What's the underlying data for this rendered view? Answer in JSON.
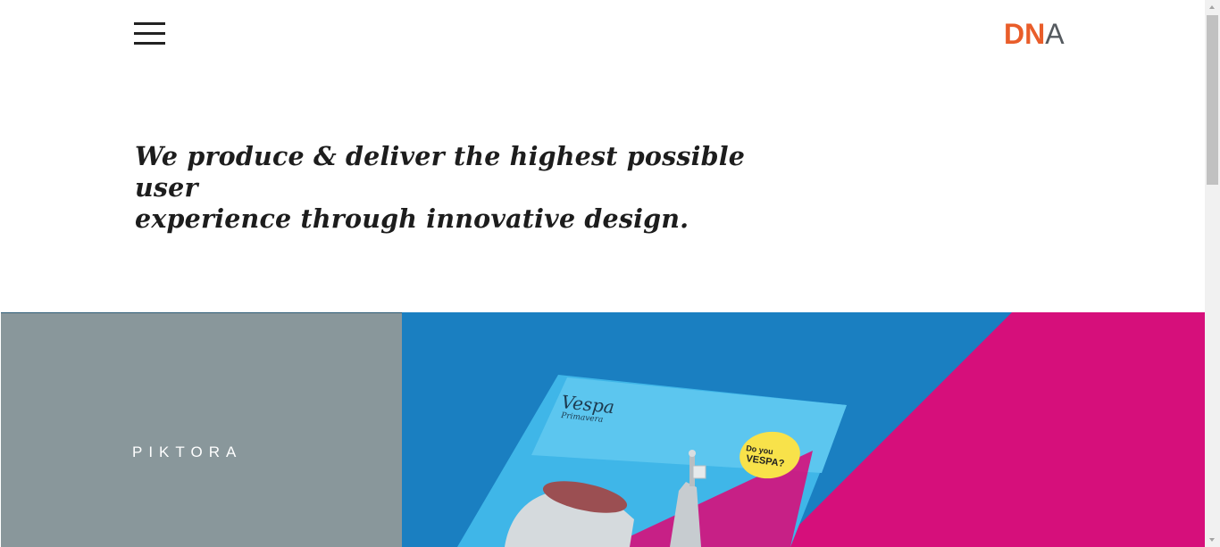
{
  "header": {
    "menu_icon": "hamburger-menu-icon",
    "logo": {
      "part_1": "DN",
      "part_2": "A",
      "accent_color": "#e95d2a",
      "text_color": "#555a5f"
    }
  },
  "hero": {
    "tagline_line_1": "We produce & deliver the highest possible user",
    "tagline_line_2": "experience through innovative design."
  },
  "projects": [
    {
      "name": "PIKTORA",
      "background": "#89979b"
    },
    {
      "image_brand": "Vespa",
      "image_subtitle": "Primavera",
      "image_badge_line_1": "Do you",
      "image_badge_line_2": "VESPA?",
      "colors": {
        "blue": "#1a7fc1",
        "magenta": "#d60f7b",
        "sky": "#3fb6e8",
        "yellow": "#f8e24a"
      }
    }
  ]
}
